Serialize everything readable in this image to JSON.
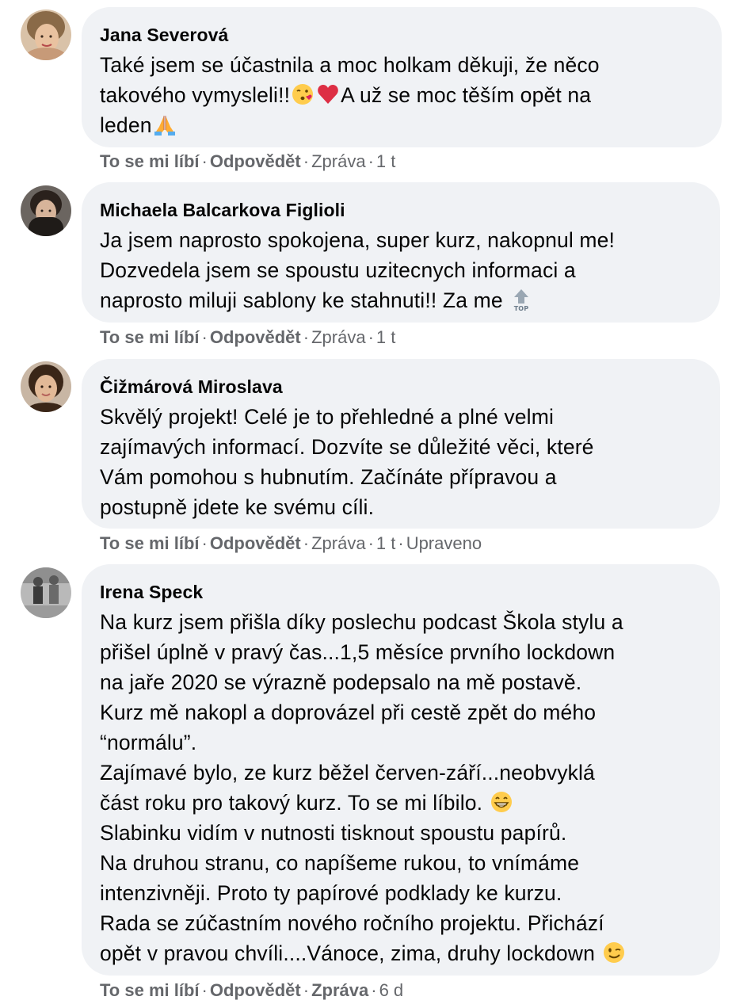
{
  "comments": [
    {
      "author": "Jana Severová",
      "lines": [
        "Také jsem se účastnila a moc holkam děkuji, že něco",
        "takového vymysleli!!",
        "A už se moc těším opět na",
        "leden"
      ],
      "emojis": [
        "kissing-face-emoji",
        "red-heart-emoji",
        "folded-hands-emoji"
      ],
      "actions": {
        "like": "To se mi líbí",
        "reply": "Odpovědět",
        "report": "Zpráva",
        "time": "1 t"
      }
    },
    {
      "author": "Michaela Balcarkova Figlioli",
      "lines": [
        "Ja jsem naprosto spokojena, super kurz, nakopnul me!",
        "Dozvedela jsem se spoustu uzitecnych informaci a",
        "naprosto miluji sablony ke stahnuti!! Za me"
      ],
      "emojis": [
        "top-arrow-emoji"
      ],
      "top_label": "TOP",
      "actions": {
        "like": "To se mi líbí",
        "reply": "Odpovědět",
        "report": "Zpráva",
        "time": "1 t"
      }
    },
    {
      "author": "Čižmárová Miroslava",
      "lines": [
        "Skvělý projekt! Celé je to přehledné a plné velmi",
        "zajímavých informací. Dozvíte se důležité věci, které",
        "Vám pomohou s hubnutím. Začínáte přípravou a",
        "postupně jdete ke svému cíli."
      ],
      "actions": {
        "like": "To se mi líbí",
        "reply": "Odpovědět",
        "report": "Zpráva",
        "time": "1 t",
        "edited": "Upraveno"
      }
    },
    {
      "author": "Irena Speck",
      "lines": [
        "Na kurz jsem přišla díky poslechu podcast Škola stylu a",
        "přišel úplně v pravý čas...1,5 měsíce prvního lockdown",
        "na jaře 2020 se výrazně podepsalo na mě postavě.",
        "Kurz mě nakopl a doprovázel při cestě zpět do mého",
        "“normálu”.",
        "Zajímavé bylo, ze kurz běžel červen-září...neobvyklá",
        "část roku pro takový kurz. To se mi líbilo.",
        "Slabinku vidím v nutnosti tisknout spoustu papírů.",
        "Na druhou stranu, co napíšeme rukou, to vnímáme",
        "intenzivněji. Proto ty papírové podklady ke kurzu.",
        "Rada se zúčastním nového ročního projektu. Přichází",
        "opět v pravou chvíli....Vánoce, zima, druhy lockdown"
      ],
      "emojis": [
        "grinning-face-emoji",
        "winking-face-emoji"
      ],
      "actions": {
        "like": "To se mi líbí",
        "reply": "Odpovědět",
        "report": "Zpráva",
        "time": "6 d"
      }
    }
  ],
  "colors": {
    "bubble": "#f0f2f5",
    "meta": "#65676b",
    "text": "#050505"
  }
}
